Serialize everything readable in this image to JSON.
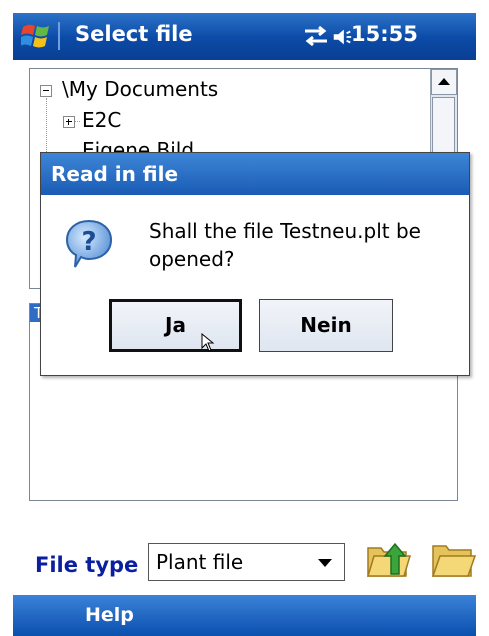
{
  "titlebar": {
    "title": "Select file",
    "time": "15:55",
    "start_icon": "windows-start-icon",
    "status_icons": [
      "connectivity-icon",
      "volume-icon"
    ]
  },
  "tree": {
    "root": "\\My Documents",
    "items": [
      "E2C",
      "Eigene Bild"
    ]
  },
  "list": {
    "header": "T"
  },
  "dialog": {
    "title": "Read in file",
    "message": "Shall the file Testneu.plt be opened?",
    "yes_label": "Ja",
    "no_label": "Nein",
    "icon": "question-icon"
  },
  "filetype": {
    "label": "File type",
    "selected": "Plant file",
    "up_icon": "folder-up-icon",
    "open_icon": "folder-open-icon"
  },
  "menubar": {
    "help_label": "Help"
  },
  "colors": {
    "title_blue": "#0b4aa6",
    "label_blue": "#0a1fa0"
  }
}
